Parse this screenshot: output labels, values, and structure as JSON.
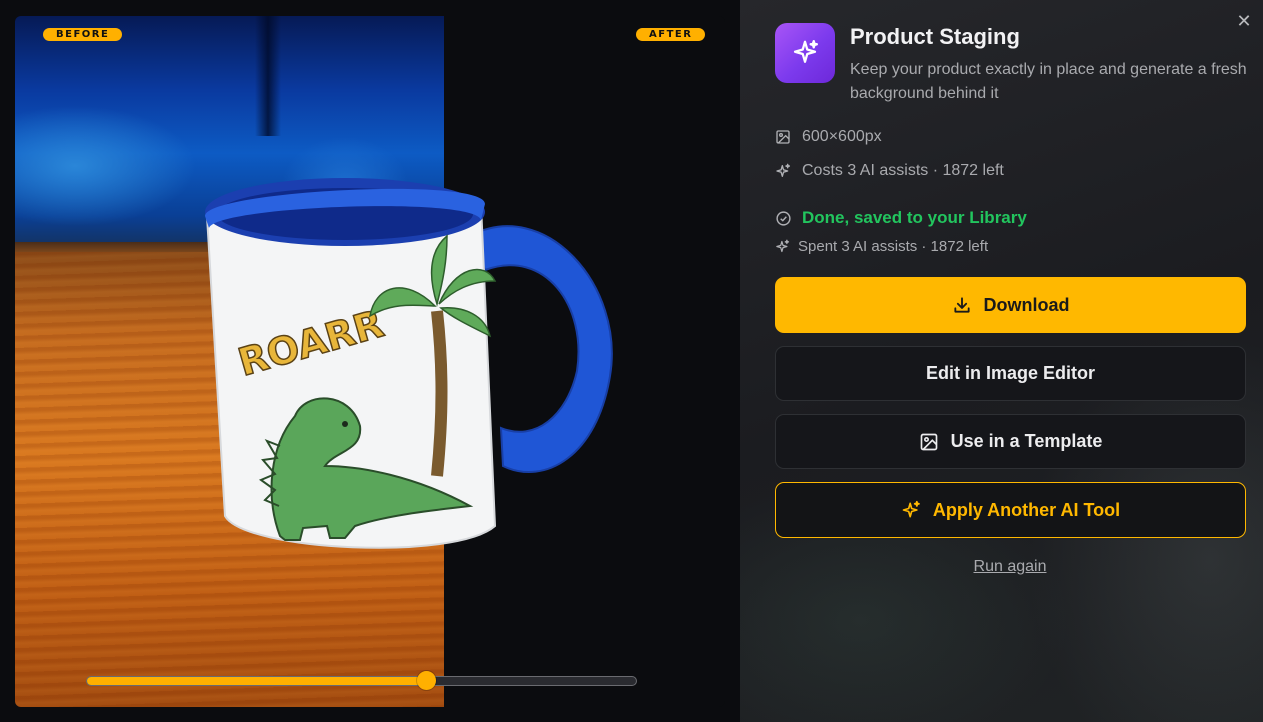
{
  "compare": {
    "before_label": "BEFORE",
    "after_label": "AFTER",
    "slider_value": 0.62
  },
  "mug": {
    "text": "ROARR"
  },
  "panel": {
    "title": "Product Staging",
    "subtitle": "Keep your product exactly in place and generate a fresh background behind it",
    "dimensions": "600×600px",
    "cost": "Costs 3 AI assists · 1872 left",
    "status": "Done, saved to your Library",
    "spent": "Spent 3 AI assists · 1872 left",
    "buttons": {
      "download": "Download",
      "edit": "Edit in Image Editor",
      "template": "Use in a Template",
      "another": "Apply Another AI Tool"
    },
    "run_again": "Run again"
  },
  "icons": {
    "tool": "sparkle-icon",
    "close": "close-icon",
    "image": "image-icon",
    "sparkle": "sparkle-icon",
    "check": "check-circle-icon",
    "download": "download-icon"
  },
  "colors": {
    "accent": "#ffb800",
    "success": "#22c55e",
    "tool_gradient_start": "#a855f7",
    "tool_gradient_end": "#6d28d9"
  }
}
